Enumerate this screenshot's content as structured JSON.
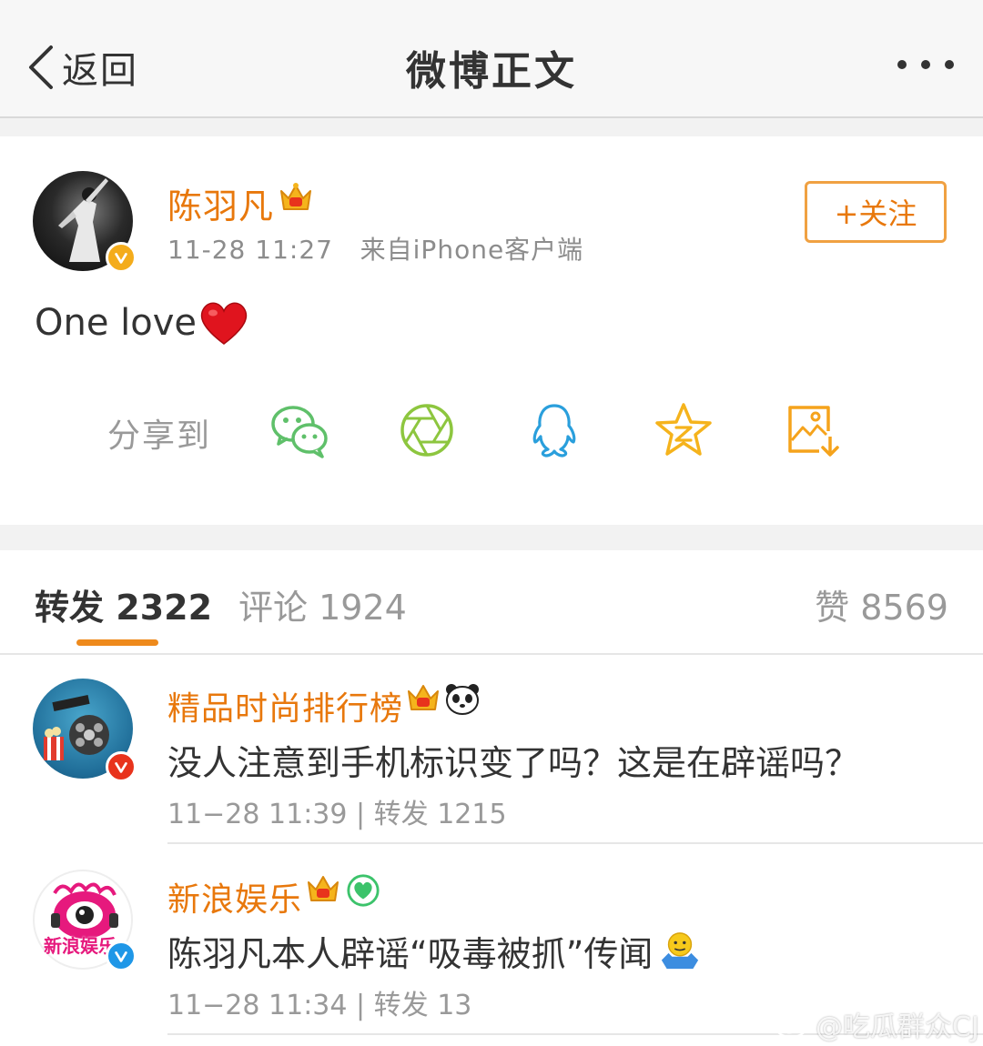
{
  "nav": {
    "back_label": "返回",
    "title": "微博正文",
    "more_icon": "ellipsis-icon"
  },
  "post": {
    "author": "陈羽凡",
    "time": "11-28 11:27",
    "source": "来自iPhone客户端",
    "follow_label": "+关注",
    "text": "One love",
    "emoji": "red-heart",
    "share_label": "分享到",
    "share_targets": [
      "wechat-icon",
      "moments-icon",
      "qq-icon",
      "qzone-icon",
      "save-image-icon"
    ]
  },
  "tabs": {
    "repost": {
      "label": "转发",
      "count": "2322"
    },
    "comment": {
      "label": "评论",
      "count": "1924"
    },
    "like": {
      "label": "赞",
      "count": "8569"
    }
  },
  "reposts": [
    {
      "name": "精品时尚排行榜",
      "text": "没人注意到手机标识变了吗？这是在辟谣吗？",
      "meta": "11−28 11:39 | 转发 1215"
    },
    {
      "name": "新浪娱乐",
      "text": "陈羽凡本人辟谣“吸毒被抓”传闻",
      "meta": "11−28 11:34 | 转发 13",
      "avatar_text": "新浪娱乐"
    }
  ],
  "watermark": "@吃瓜群众CJ",
  "colors": {
    "accent": "#e8780c",
    "follow_border": "#f0a142",
    "tab_underline": "#ee8a1c",
    "gold_badge": "#f4ac1b",
    "red_badge": "#e8331c",
    "blue_badge": "#1f97e7"
  }
}
